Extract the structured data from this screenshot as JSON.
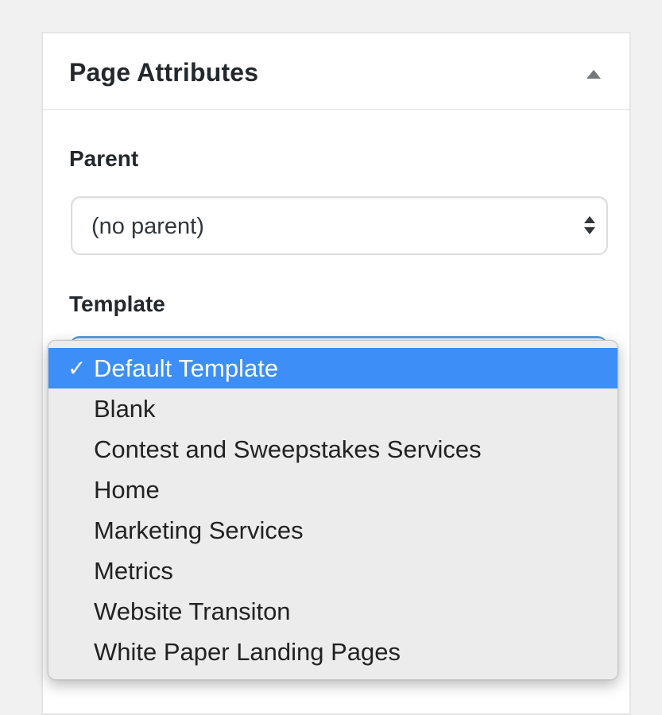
{
  "panel": {
    "title": "Page Attributes",
    "toggle_icon": "triangle-up-icon"
  },
  "parent": {
    "label": "Parent",
    "value": "(no parent)",
    "icon": "select-arrows-icon"
  },
  "template": {
    "label": "Template",
    "check_glyph": "✓",
    "options": [
      {
        "label": "Default Template",
        "selected": true
      },
      {
        "label": "Blank",
        "selected": false
      },
      {
        "label": "Contest and Sweepstakes Services",
        "selected": false
      },
      {
        "label": "Home",
        "selected": false
      },
      {
        "label": "Marketing Services",
        "selected": false
      },
      {
        "label": "Metrics",
        "selected": false
      },
      {
        "label": "Website Transiton",
        "selected": false
      },
      {
        "label": "White Paper Landing Pages",
        "selected": false
      }
    ]
  },
  "colors": {
    "selected_bg": "#3d8ef6",
    "focus_border": "#5b9dd9",
    "panel_bg": "#ffffff",
    "page_bg": "#f1f1f1"
  }
}
